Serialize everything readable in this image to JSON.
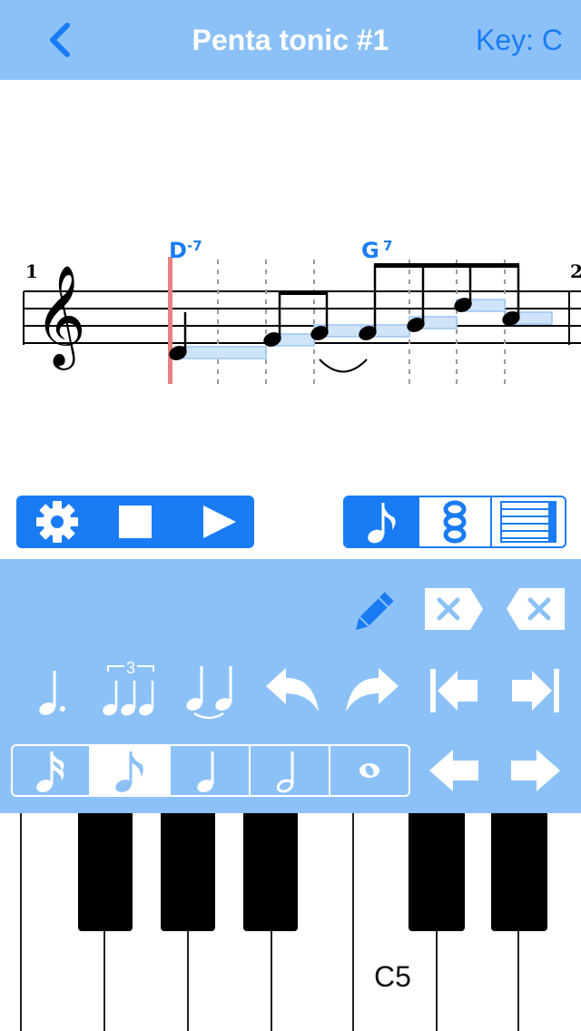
{
  "nav": {
    "title": "Penta tonic #1",
    "key_label": "Key: C",
    "back_icon": "chevron-left-icon"
  },
  "score": {
    "measure_start": "1",
    "measure_next": "2",
    "chords": [
      {
        "root": "D",
        "quality": "-7"
      },
      {
        "root": "G",
        "quality": "7"
      }
    ]
  },
  "transport": {
    "icons": [
      "gear-icon",
      "stop-icon",
      "play-icon"
    ]
  },
  "view_modes": {
    "selected": 0,
    "icons": [
      "eighth-note-icon",
      "chord-stack-icon",
      "piano-roll-icon"
    ]
  },
  "triplet_label": "3",
  "durations": {
    "selected": 1,
    "icons": [
      "sixteenth-note-icon",
      "eighth-note-icon",
      "quarter-note-icon",
      "half-note-icon",
      "whole-note-icon"
    ]
  },
  "keyboard": {
    "label": "C5"
  },
  "colors": {
    "accent": "#1a7cf5",
    "panel": "#8cc1f7",
    "playhead": "#e88080",
    "piano_roll": "#cfe3f9"
  }
}
